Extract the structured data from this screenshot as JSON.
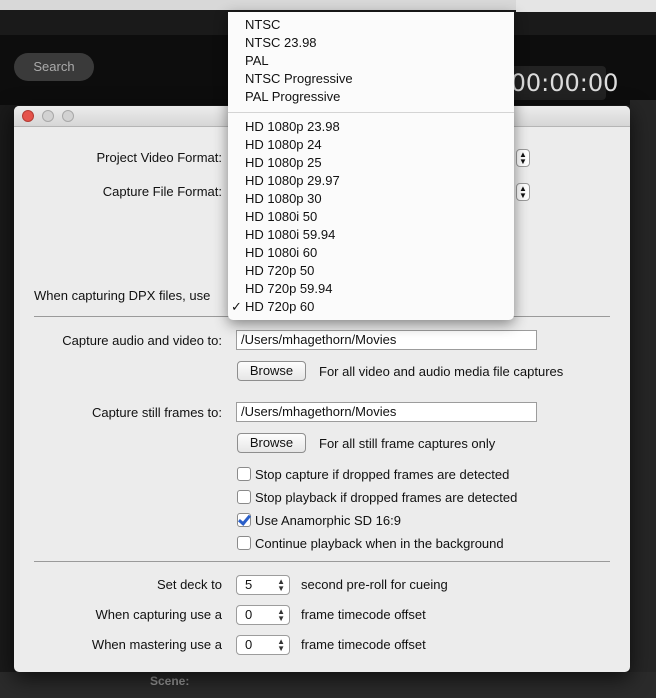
{
  "background": {
    "search_label": "Search",
    "timecode": "00:00:00:00",
    "scene_label": "Scene:"
  },
  "dialog": {
    "project_video_format_label": "Project Video Format:",
    "capture_file_format_label": "Capture File Format:",
    "dpx_label": "When capturing DPX files, use",
    "capture_av_label": "Capture audio and video to:",
    "capture_av_path": "/Users/mhagethorn/Movies",
    "browse_label": "Browse",
    "capture_av_hint": "For all video and audio media file captures",
    "capture_still_label": "Capture still frames to:",
    "capture_still_path": "/Users/mhagethorn/Movies",
    "capture_still_hint": "For all still frame captures only",
    "checkboxes": [
      {
        "label": "Stop capture if dropped frames are detected",
        "checked": false
      },
      {
        "label": "Stop playback if dropped frames are detected",
        "checked": false
      },
      {
        "label": "Use Anamorphic SD 16:9",
        "checked": true
      },
      {
        "label": "Continue playback when in the background",
        "checked": false
      }
    ],
    "set_deck_label": "Set deck to",
    "preroll_value": "5",
    "preroll_hint": "second pre-roll for cueing",
    "capturing_label": "When capturing use a",
    "capturing_value": "0",
    "capturing_hint": "frame timecode offset",
    "mastering_label": "When mastering use a",
    "mastering_value": "0",
    "mastering_hint": "frame timecode offset"
  },
  "format_menu": {
    "group1": [
      "NTSC",
      "NTSC 23.98",
      "PAL",
      "NTSC Progressive",
      "PAL Progressive"
    ],
    "group2": [
      "HD 1080p 23.98",
      "HD 1080p 24",
      "HD 1080p 25",
      "HD 1080p 29.97",
      "HD 1080p 30",
      "HD 1080i 50",
      "HD 1080i 59.94",
      "HD 1080i 60",
      "HD 720p 50",
      "HD 720p 59.94",
      "HD 720p 60"
    ],
    "selected": "HD 720p 60",
    "checkmark": "✓"
  }
}
